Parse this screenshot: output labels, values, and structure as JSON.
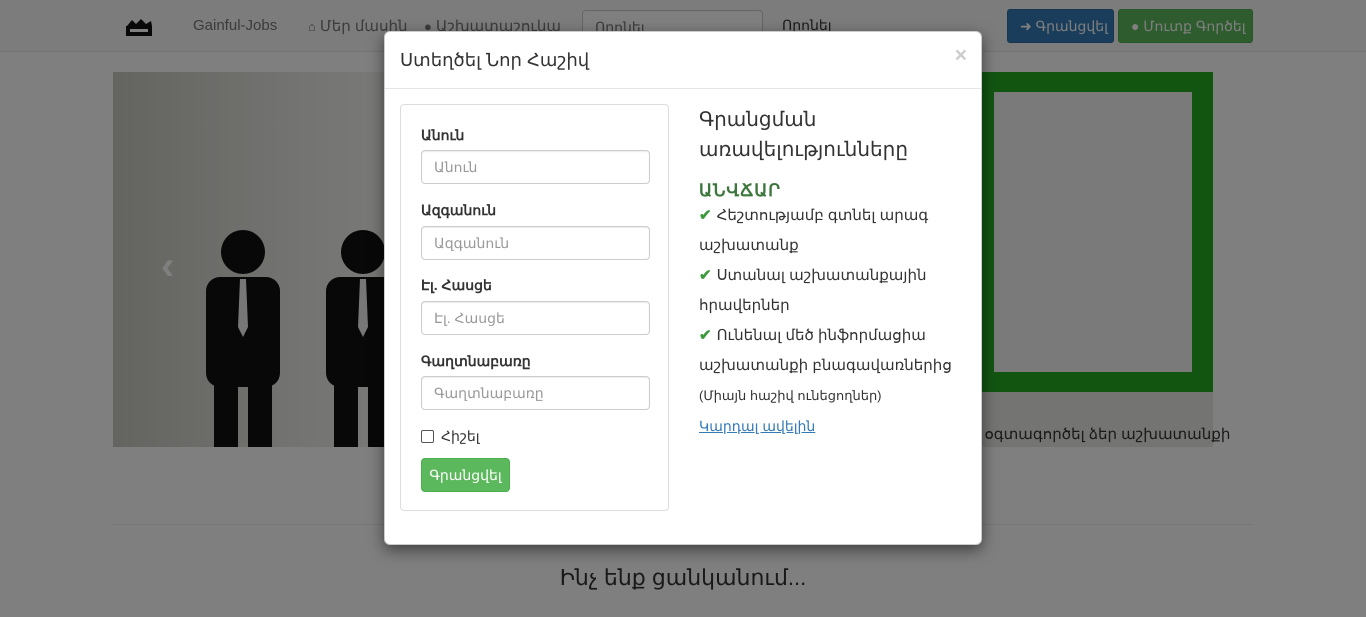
{
  "navbar": {
    "brand": "Gainful-Jobs",
    "about": "Մեր մասին",
    "employers": "Աշխատաշուկա",
    "search_placeholder": "Որոնել",
    "search_button": "Որոնել",
    "register_button": "Գրանցվել",
    "login_button": "Մուտք Գործել"
  },
  "page": {
    "side_text": "... օգտագործել ձեր աշխատանքի",
    "section_heading": "Ինչ ենք ցանկանում..."
  },
  "modal": {
    "title": "Ստեղծել Նոր Հաշիվ",
    "close": "×",
    "form": {
      "first_name_label": "Անուն",
      "first_name_placeholder": "Անուն",
      "last_name_label": "Ազգանուն",
      "last_name_placeholder": "Ազգանուն",
      "email_label": "Էլ. Հասցե",
      "email_placeholder": "Էլ. Հասցե",
      "password_label": "Գաղտնաբառը",
      "password_placeholder": "Գաղտնաբառը",
      "remember_label": "Հիշել",
      "submit_label": "Գրանցվել"
    },
    "benefits": {
      "title": "Գրանցման առավելությունները",
      "free_tag": "ԱՆՎՃԱՐ",
      "items": [
        "Հեշտությամբ գտնել արագ աշխատանք",
        "Ստանալ աշխատանքային հրավերներ",
        "Ունենալ մեծ ինֆորմացիա աշխատանքի բնագավառներից"
      ],
      "note": "(Միայն հաշիվ ունեցողներ)",
      "more_link": "Կարդալ ավելին"
    }
  },
  "colors": {
    "primary": "#337ab7",
    "success": "#5cb85c",
    "free_tag": "#3c763d"
  }
}
